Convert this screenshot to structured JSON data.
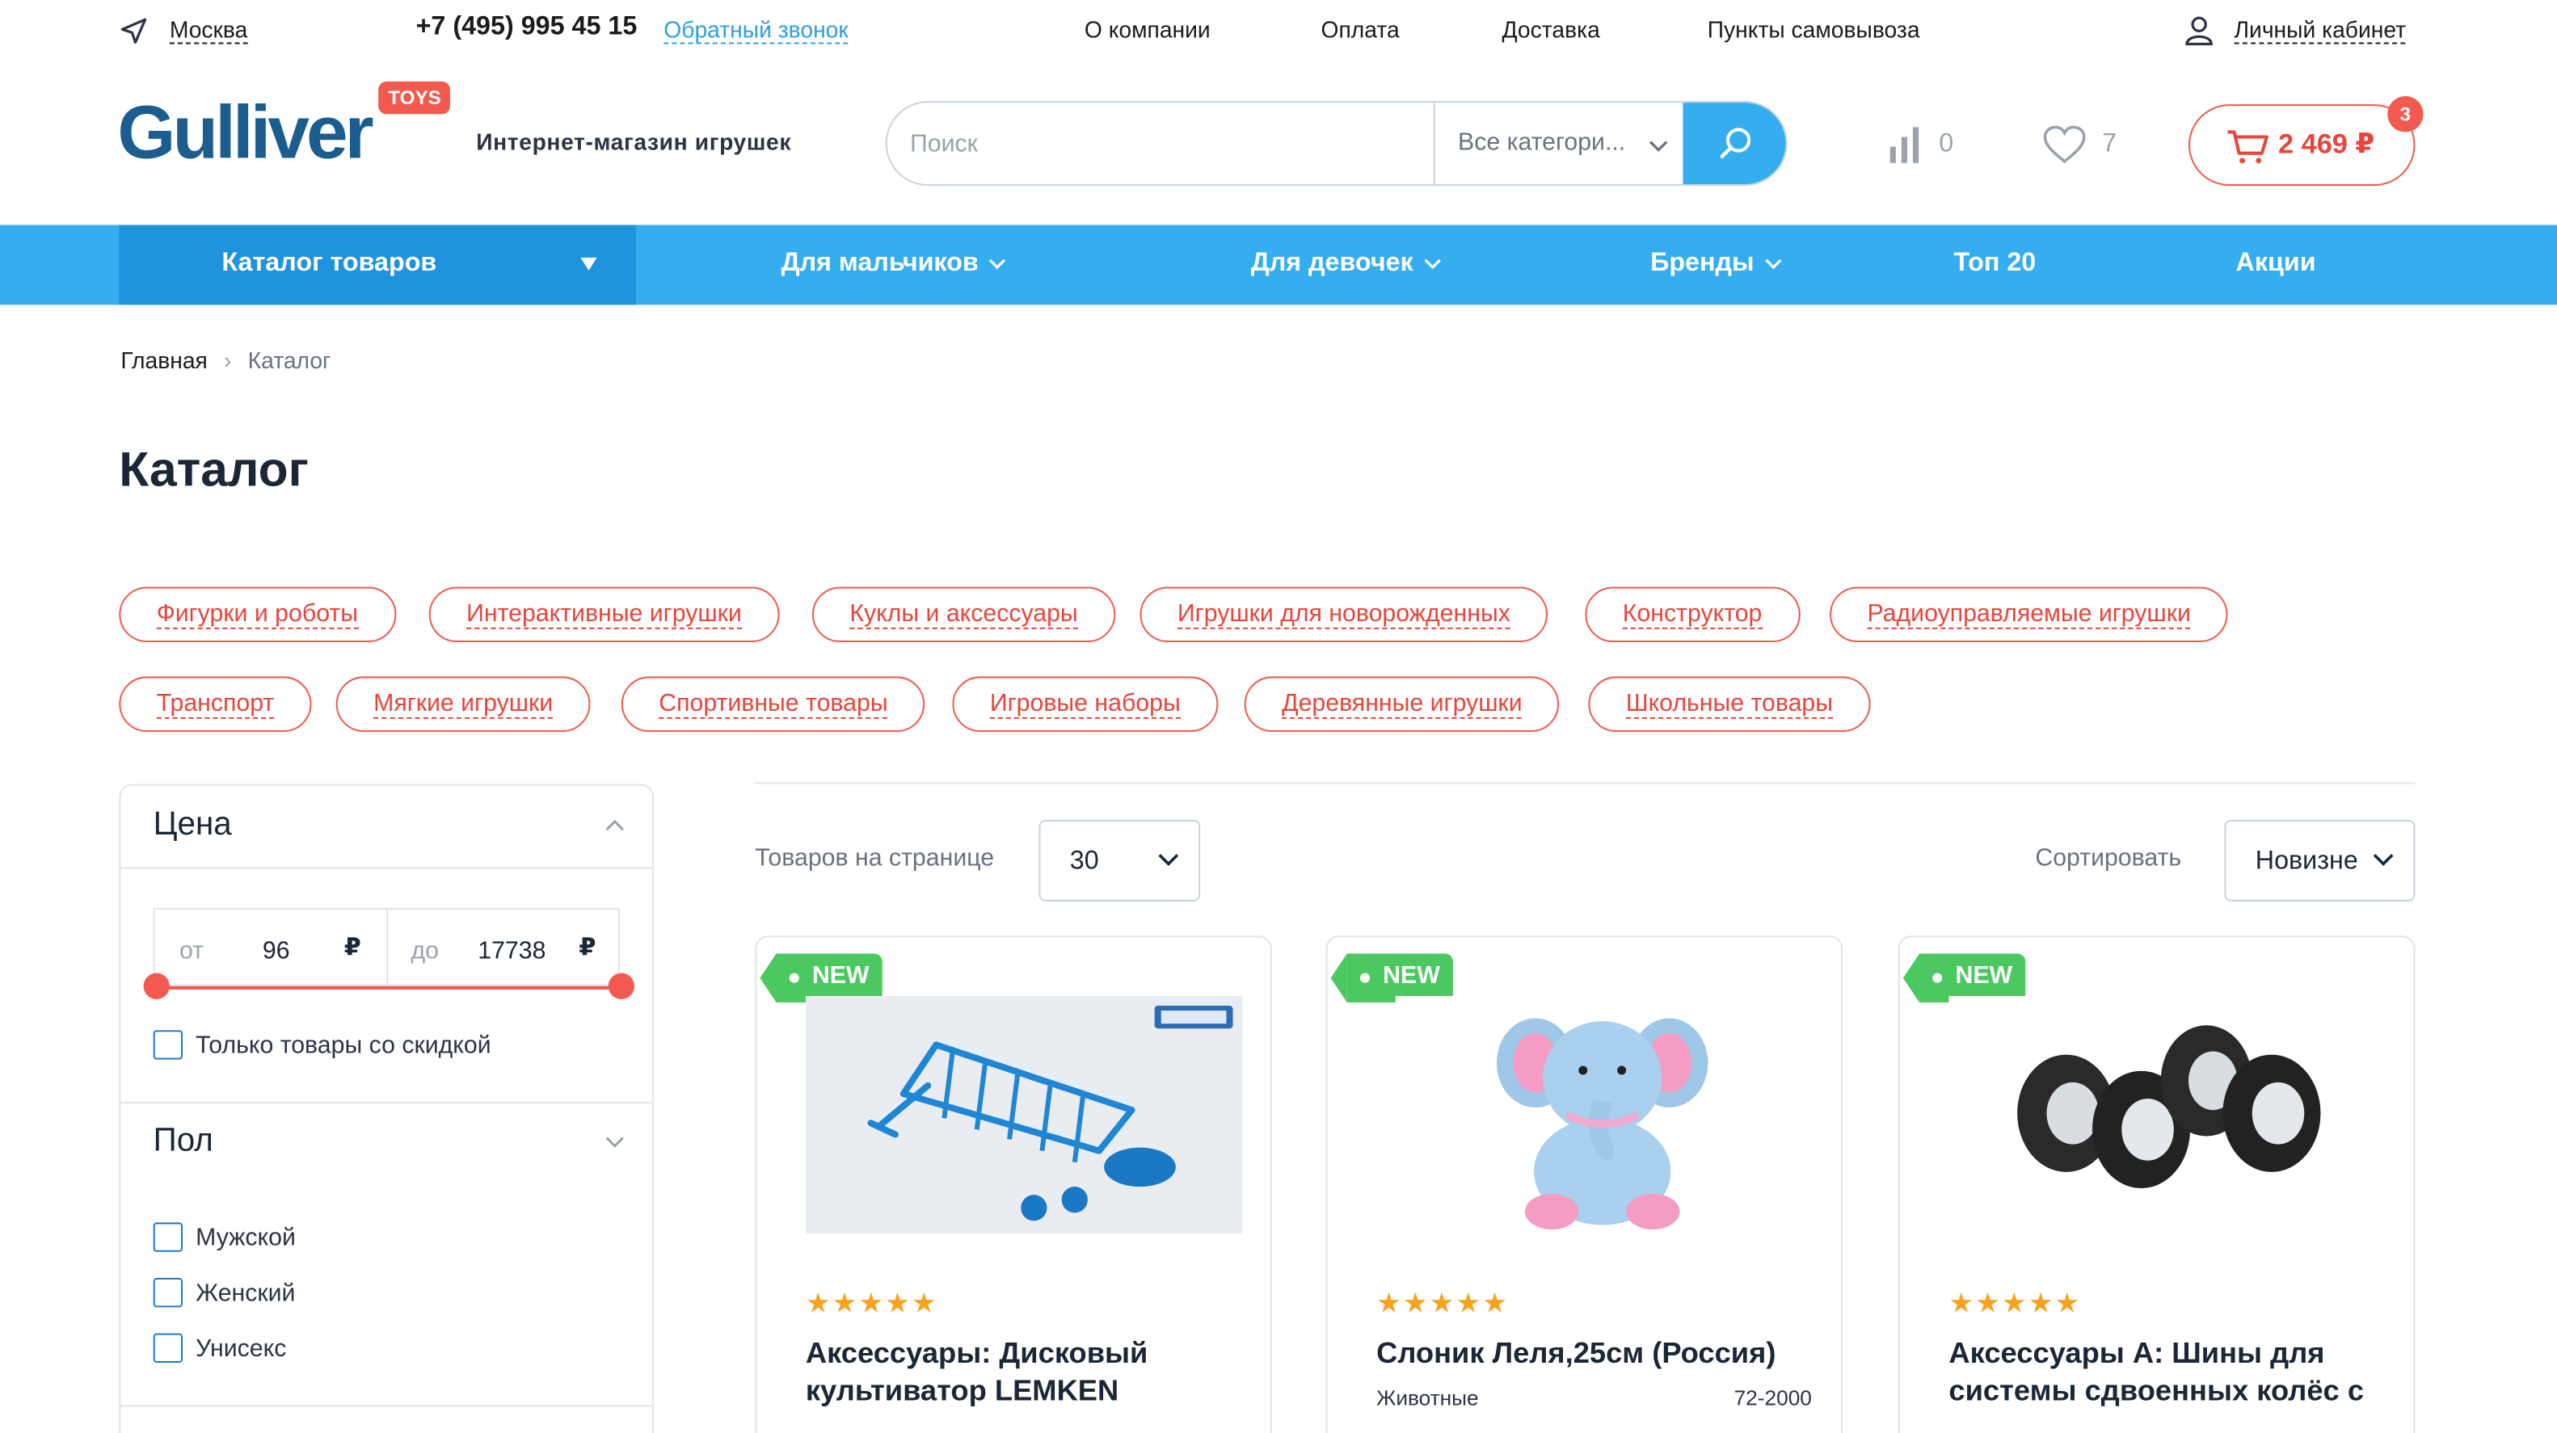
{
  "topbar": {
    "city": "Москва",
    "phone": "+7 (495) 995 45 15",
    "callback": "Обратный звонок",
    "links": [
      "О компании",
      "Оплата",
      "Доставка",
      "Пункты самовывоза"
    ],
    "account": "Личный кабинет"
  },
  "header": {
    "logo_text": "Gulliver",
    "logo_badge": "TOYS",
    "tagline": "Интернет-магазин игрушек",
    "search_placeholder": "Поиск",
    "search_category": "Все категори...",
    "compare_count": "0",
    "favorites_count": "7",
    "cart_total": "2 469 ₽",
    "cart_count": "3"
  },
  "nav": {
    "catalog": "Каталог товаров",
    "items": [
      "Для мальчиков",
      "Для девочек",
      "Бренды",
      "Топ 20",
      "Акции"
    ]
  },
  "breadcrumb": {
    "home": "Главная",
    "separator": "›",
    "current": "Каталог"
  },
  "page_title": "Каталог",
  "categories": [
    "Фигурки и роботы",
    "Интерактивные игрушки",
    "Куклы и аксессуары",
    "Игрушки для новорожденных",
    "Конструктор",
    "Радиоуправляемые игрушки",
    "Транспорт",
    "Мягкие игрушки",
    "Спортивные товары",
    "Игровые наборы",
    "Деревянные игрушки",
    "Школьные товары"
  ],
  "filter": {
    "price_title": "Цена",
    "from_label": "от",
    "from_value": "96",
    "to_label": "до",
    "to_value": "17738",
    "currency": "₽",
    "discount_only": "Только товары со скидкой",
    "gender_title": "Пол",
    "gender_options": [
      "Мужской",
      "Женский",
      "Унисекс"
    ]
  },
  "toolbar": {
    "per_page_label": "Товаров на странице",
    "per_page_value": "30",
    "sort_label": "Сортировать",
    "sort_value": "Новизне"
  },
  "products": [
    {
      "badge": "NEW",
      "rating": 5,
      "stars": "★★★★★",
      "name": "Аксессуары: Дисковый культиватор LEMKEN",
      "category": "",
      "sku": ""
    },
    {
      "badge": "NEW",
      "rating": 5,
      "stars": "★★★★★",
      "name": "Слоник Леля,25см (Россия)",
      "category": "Животные",
      "sku": "72-2000"
    },
    {
      "badge": "NEW",
      "rating": 5,
      "stars": "★★★★★",
      "name": "Аксессуары А: Шины для системы сдвоенных колёс с",
      "category": "",
      "sku": ""
    }
  ],
  "colors": {
    "accent_blue": "#35aef0",
    "accent_red": "#f25a4f",
    "new_green": "#4cc860",
    "brand_navy": "#1c5d8f"
  }
}
